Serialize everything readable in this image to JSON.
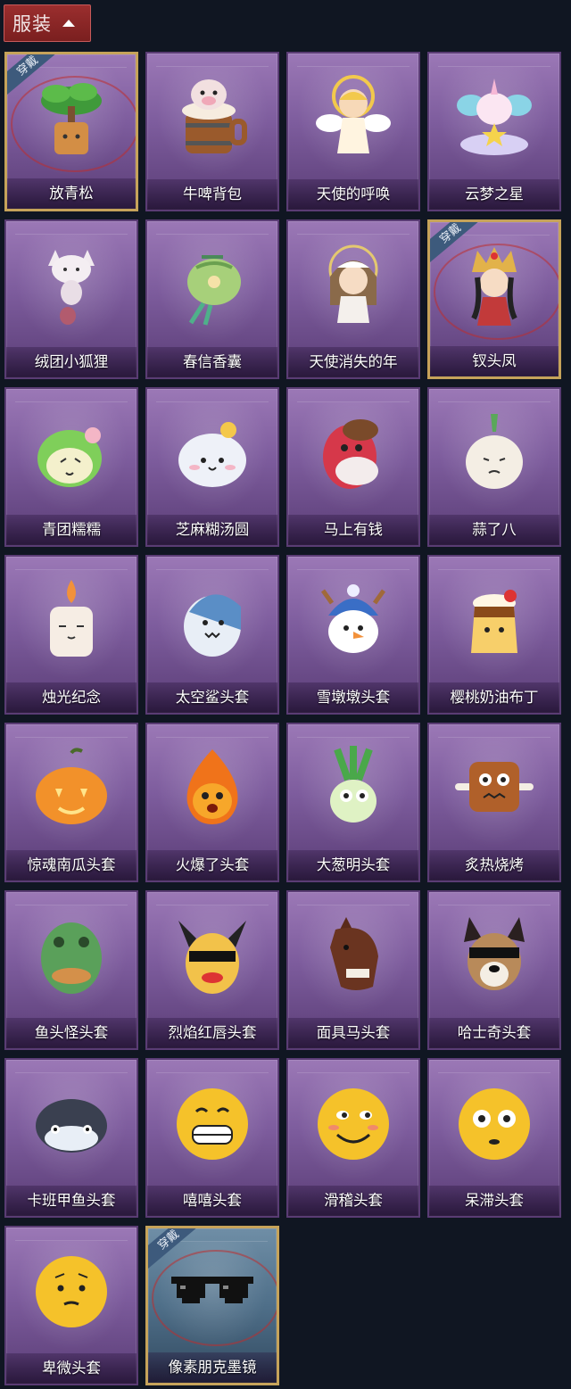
{
  "header": {
    "title": "服装"
  },
  "badge_text": "穿戴",
  "items": [
    {
      "label": "放青松",
      "icon": "bonsai-pine-icon",
      "equipped": true,
      "style": "gold"
    },
    {
      "label": "牛啤背包",
      "icon": "cow-beer-barrel-icon",
      "equipped": false,
      "style": ""
    },
    {
      "label": "天使的呼唤",
      "icon": "angel-doll-icon",
      "equipped": false,
      "style": ""
    },
    {
      "label": "云梦之星",
      "icon": "unicorn-cloud-star-icon",
      "equipped": false,
      "style": ""
    },
    {
      "label": "绒团小狐狸",
      "icon": "fox-plush-icon",
      "equipped": false,
      "style": ""
    },
    {
      "label": "春信香囊",
      "icon": "sachet-pouch-icon",
      "equipped": false,
      "style": ""
    },
    {
      "label": "天使消失的年",
      "icon": "angel-girl-icon",
      "equipped": false,
      "style": ""
    },
    {
      "label": "钗头凤",
      "icon": "phoenix-crown-doll-icon",
      "equipped": true,
      "style": "gold"
    },
    {
      "label": "青团糯糯",
      "icon": "green-dumpling-icon",
      "equipped": false,
      "style": ""
    },
    {
      "label": "芝麻糊汤圆",
      "icon": "rice-ball-icon",
      "equipped": false,
      "style": ""
    },
    {
      "label": "马上有钱",
      "icon": "red-horse-icon",
      "equipped": false,
      "style": ""
    },
    {
      "label": "蒜了八",
      "icon": "garlic-icon",
      "equipped": false,
      "style": ""
    },
    {
      "label": "烛光纪念",
      "icon": "candle-icon",
      "equipped": false,
      "style": ""
    },
    {
      "label": "太空鲨头套",
      "icon": "shark-head-icon",
      "equipped": false,
      "style": ""
    },
    {
      "label": "雪墩墩头套",
      "icon": "snowman-head-icon",
      "equipped": false,
      "style": ""
    },
    {
      "label": "樱桃奶油布丁",
      "icon": "cherry-pudding-icon",
      "equipped": false,
      "style": ""
    },
    {
      "label": "惊魂南瓜头套",
      "icon": "pumpkin-head-icon",
      "equipped": false,
      "style": ""
    },
    {
      "label": "火爆了头套",
      "icon": "fire-head-icon",
      "equipped": false,
      "style": ""
    },
    {
      "label": "大葱明头套",
      "icon": "scallion-head-icon",
      "equipped": false,
      "style": ""
    },
    {
      "label": "炙热烧烤",
      "icon": "bbq-meat-icon",
      "equipped": false,
      "style": ""
    },
    {
      "label": "鱼头怪头套",
      "icon": "fish-head-icon",
      "equipped": false,
      "style": ""
    },
    {
      "label": "烈焰红唇头套",
      "icon": "yellow-mask-icon",
      "equipped": false,
      "style": ""
    },
    {
      "label": "面具马头套",
      "icon": "horse-mask-icon",
      "equipped": false,
      "style": ""
    },
    {
      "label": "哈士奇头套",
      "icon": "husky-mask-icon",
      "equipped": false,
      "style": ""
    },
    {
      "label": "卡班甲鱼头套",
      "icon": "whale-head-icon",
      "equipped": false,
      "style": ""
    },
    {
      "label": "嘻嘻头套",
      "icon": "grin-emoji-head-icon",
      "equipped": false,
      "style": ""
    },
    {
      "label": "滑稽头套",
      "icon": "smirk-emoji-head-icon",
      "equipped": false,
      "style": ""
    },
    {
      "label": "呆滞头套",
      "icon": "dazed-emoji-head-icon",
      "equipped": false,
      "style": ""
    },
    {
      "label": "卑微头套",
      "icon": "humble-emoji-head-icon",
      "equipped": false,
      "style": ""
    },
    {
      "label": "像素朋克墨镜",
      "icon": "pixel-sunglasses-icon",
      "equipped": true,
      "style": "blue"
    }
  ],
  "colors": {
    "background": "#101622",
    "header_red": "#8a2626",
    "card_purple": "#7d5c9d",
    "card_blue": "#4f6f89",
    "gold_frame": "#c6a35a",
    "badge_blue": "#3d5a7c"
  }
}
